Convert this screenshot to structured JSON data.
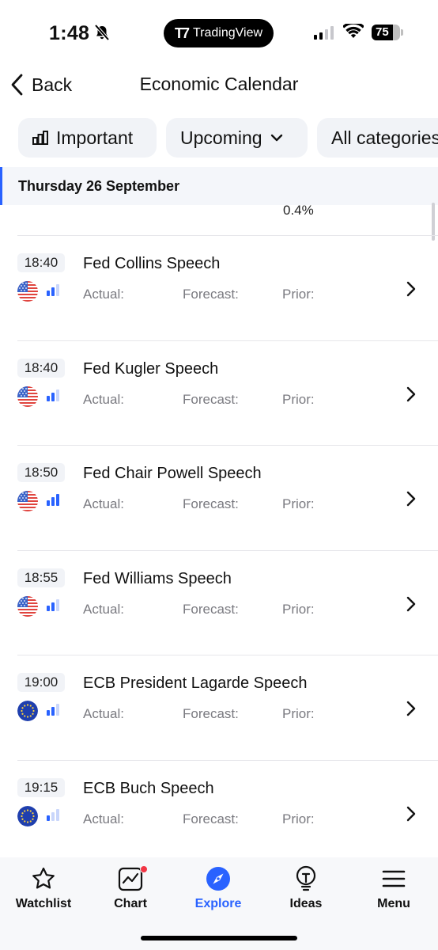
{
  "status_bar": {
    "time": "1:48",
    "dynamic_island_label": "TradingView",
    "battery_percent": "75",
    "battery_level": 0.75,
    "signal_bars_on": 2
  },
  "header": {
    "back_label": "Back",
    "title": "Economic Calendar"
  },
  "filters": {
    "important": "Important",
    "upcoming": "Upcoming",
    "categories": "All categories"
  },
  "date_header": "Thursday 26 September",
  "previous_row_value": "0.4%",
  "labels": {
    "actual": "Actual:",
    "forecast": "Forecast:",
    "prior": "Prior:"
  },
  "events": [
    {
      "time": "18:40",
      "title": "Fed Collins Speech",
      "flag": "us-flag-icon",
      "importance": 2
    },
    {
      "time": "18:40",
      "title": "Fed Kugler Speech",
      "flag": "us-flag-icon",
      "importance": 2
    },
    {
      "time": "18:50",
      "title": "Fed Chair Powell Speech",
      "flag": "us-flag-icon",
      "importance": 3
    },
    {
      "time": "18:55",
      "title": "Fed Williams Speech",
      "flag": "us-flag-icon",
      "importance": 2
    },
    {
      "time": "19:00",
      "title": "ECB President Lagarde Speech",
      "flag": "eu-flag-icon",
      "importance": 2
    },
    {
      "time": "19:15",
      "title": "ECB Buch Speech",
      "flag": "eu-flag-icon",
      "importance": 1
    }
  ],
  "tabs": [
    {
      "label": "Watchlist",
      "icon": "star-icon",
      "active": false
    },
    {
      "label": "Chart",
      "icon": "chart-icon",
      "active": false
    },
    {
      "label": "Explore",
      "icon": "compass-icon",
      "active": true
    },
    {
      "label": "Ideas",
      "icon": "lightbulb-icon",
      "active": false
    },
    {
      "label": "Menu",
      "icon": "hamburger-menu-icon",
      "active": false
    }
  ],
  "colors": {
    "accent": "#2962ff",
    "notification_dot": "#f23645",
    "label_gray": "#7a7a80"
  }
}
